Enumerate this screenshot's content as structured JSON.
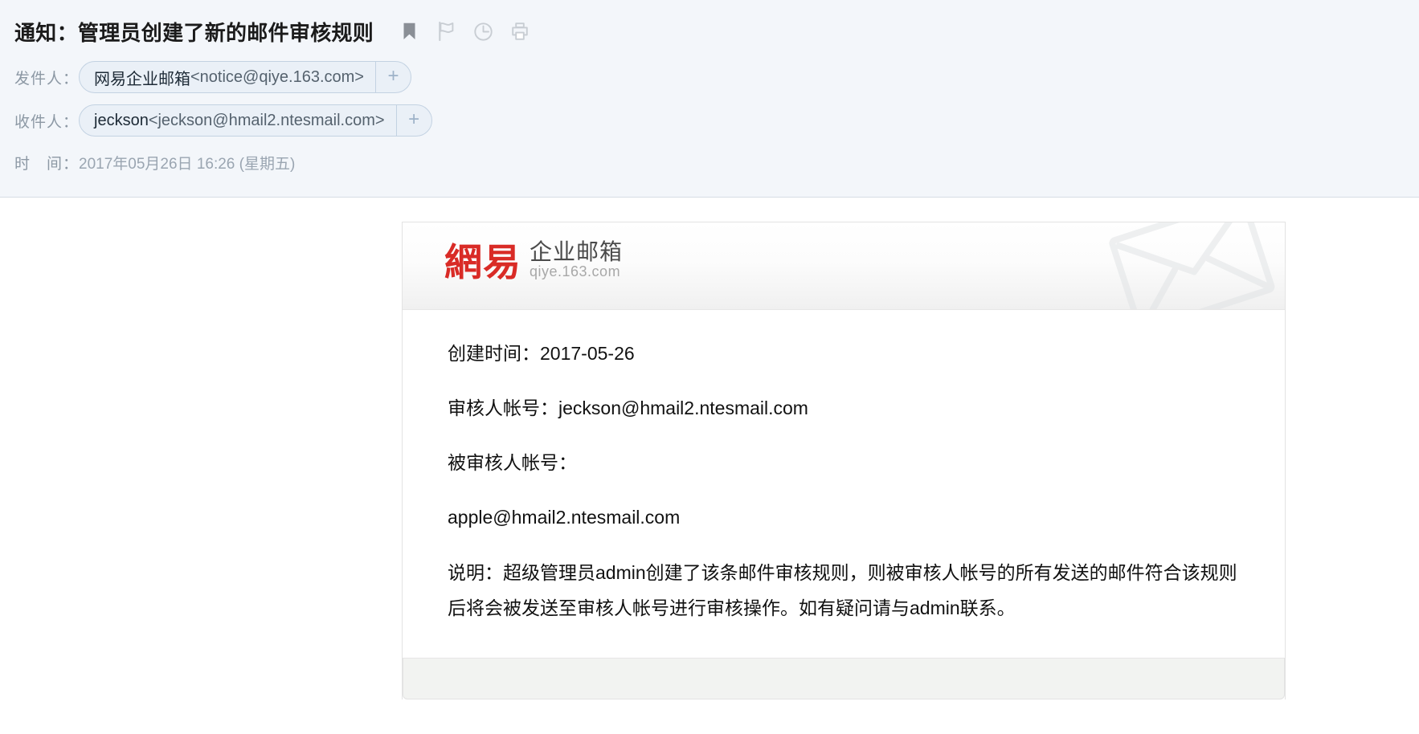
{
  "header": {
    "subject": "通知：管理员创建了新的邮件审核规则",
    "icons": [
      {
        "name": "bookmark-icon",
        "label": "标记"
      },
      {
        "name": "flag-icon",
        "label": "旗标"
      },
      {
        "name": "clock-icon",
        "label": "定时"
      },
      {
        "name": "print-icon",
        "label": "打印"
      }
    ],
    "from": {
      "label": "发件人：",
      "display_name": "网易企业邮箱",
      "address": "<notice@qiye.163.com>",
      "plus": "+"
    },
    "to": {
      "label": "收件人：",
      "display_name": "jeckson",
      "address": "<jeckson@hmail2.ntesmail.com>",
      "plus": "+"
    },
    "time": {
      "label": "时　间：",
      "value": "2017年05月26日 16:26 (星期五)"
    }
  },
  "card": {
    "brand": {
      "mark": "網易",
      "cn": "企业邮箱",
      "en": "qiye.163.com",
      "mark_color": "#d92b26"
    },
    "lines": {
      "created_time": "创建时间：2017-05-26",
      "reviewer_account": "审核人帐号：jeckson@hmail2.ntesmail.com",
      "reviewed_account_label": "被审核人帐号：",
      "reviewed_account_value": "apple@hmail2.ntesmail.com",
      "description": "说明：超级管理员admin创建了该条邮件审核规则，则被审核人帐号的所有发送的邮件符合该规则后将会被发送至审核人帐号进行审核操作。如有疑问请与admin联系。"
    }
  }
}
